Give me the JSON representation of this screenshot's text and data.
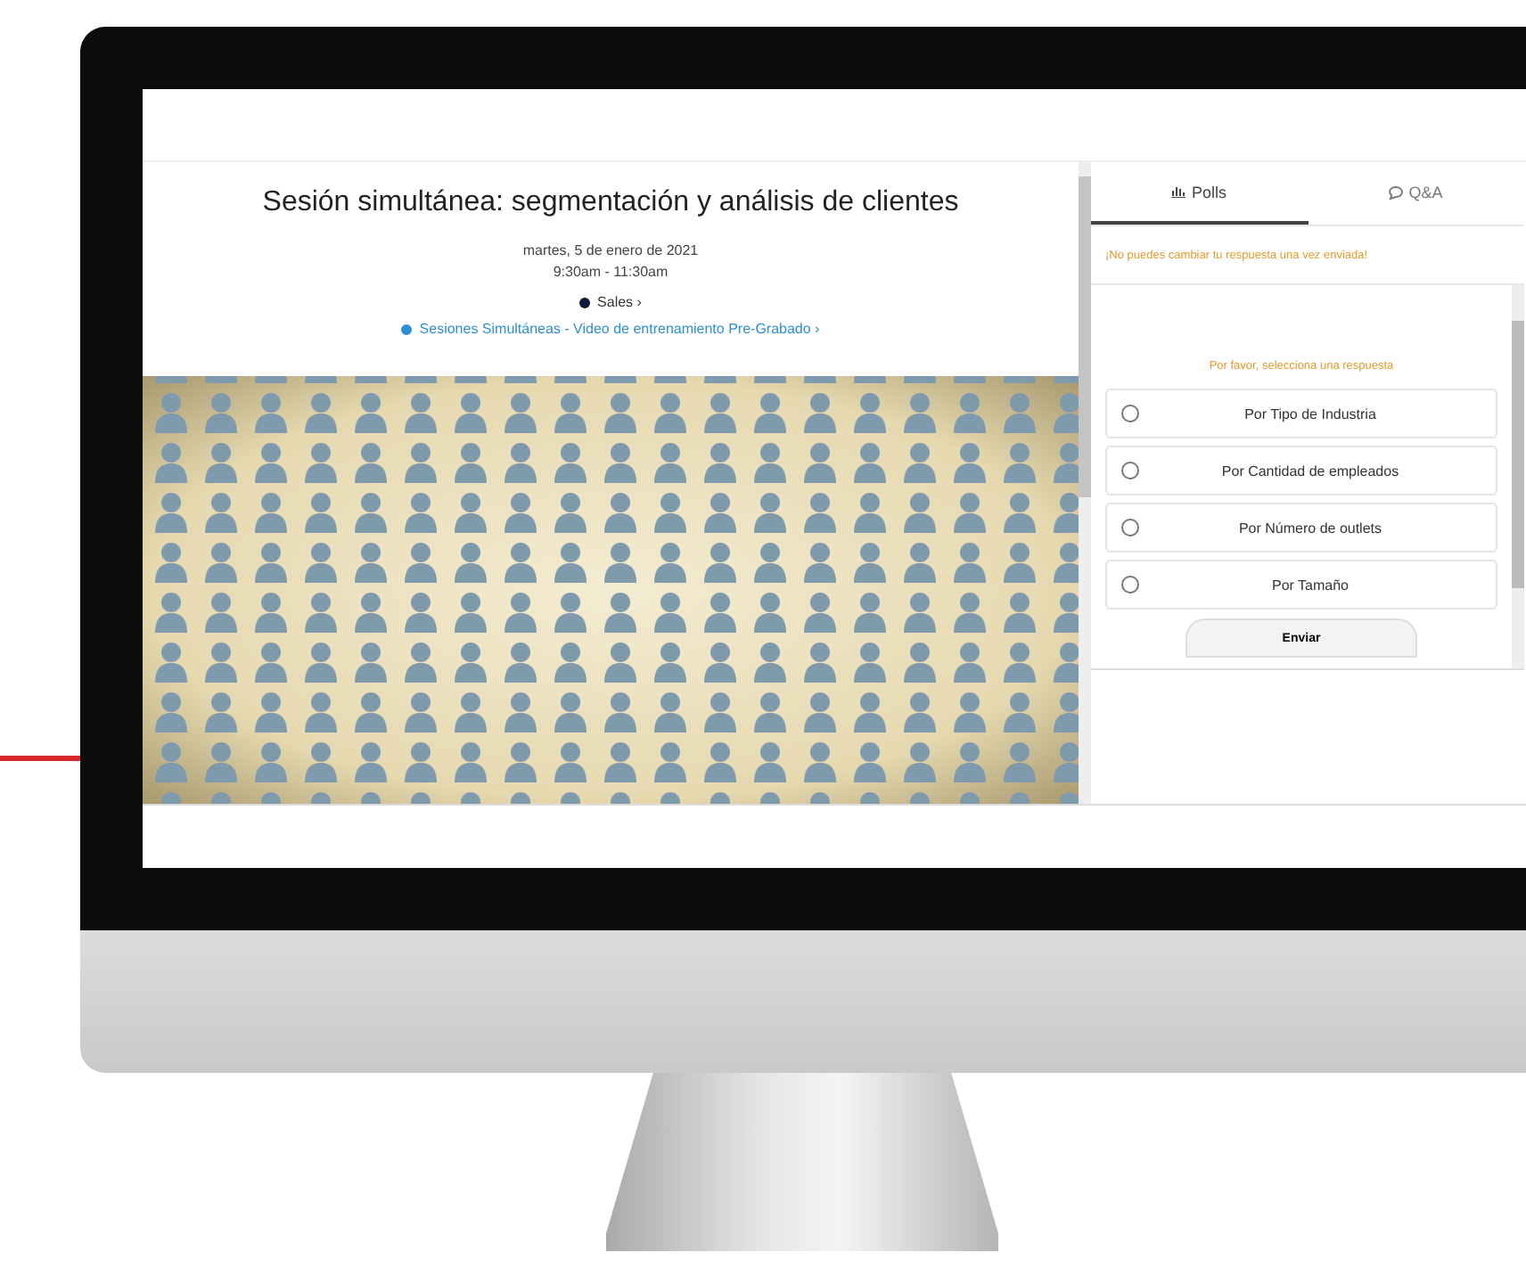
{
  "session": {
    "title": "Sesión simultánea: segmentación y análisis de clientes",
    "date": "martes, 5 de enero de 2021",
    "time": "9:30am - 11:30am",
    "tags": [
      {
        "label": "Sales ›",
        "color": "#0d1b3a"
      },
      {
        "label": "Sesiones Simultáneas - Video de entrenamiento Pre-Grabado ›",
        "color": "#2d8fd6"
      }
    ]
  },
  "poll": {
    "tabs": [
      {
        "label": "Polls",
        "kind": "chart",
        "selected": true
      },
      {
        "label": "Q&A",
        "kind": "chat",
        "selected": false
      }
    ],
    "warning": "¡No puedes cambiar tu respuesta una vez enviada!",
    "prompt": "Por favor, selecciona una respuesta",
    "options": [
      {
        "label": "Por Tipo de Industria",
        "selected": false
      },
      {
        "label": "Por Cantidad de empleados",
        "selected": false
      },
      {
        "label": "Por Número de outlets",
        "selected": false
      },
      {
        "label": "Por Tamaño",
        "selected": false
      }
    ],
    "submit": "Enviar"
  }
}
